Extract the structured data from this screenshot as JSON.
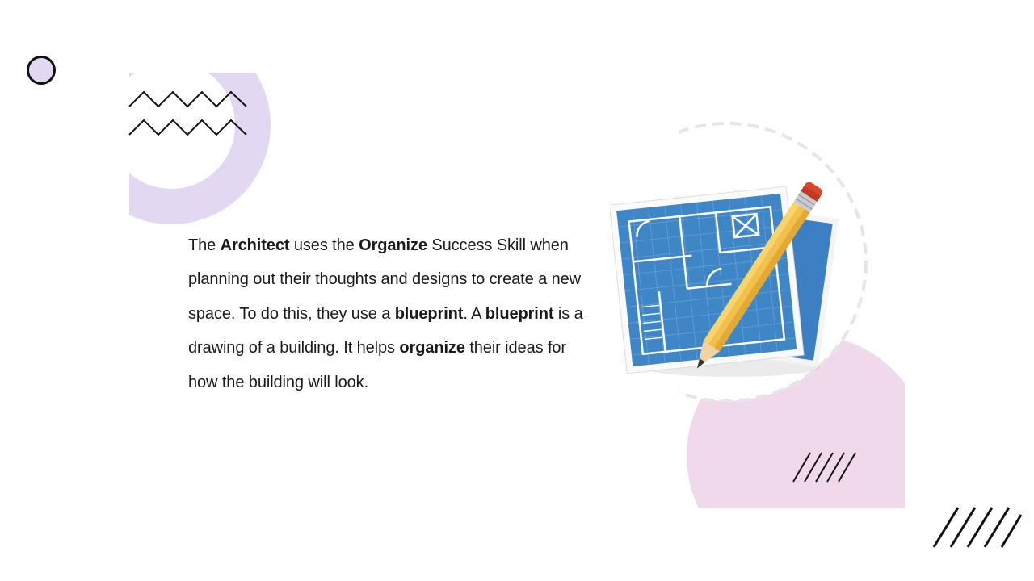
{
  "slide": {
    "paragraph": {
      "t1": "The ",
      "b1": "Architect",
      "t2": " uses the ",
      "b2": "Organize",
      "t3": " Success Skill when planning out their thoughts and designs to create a new space. To do this, they use a ",
      "b3": "blueprint",
      "t4": ". A ",
      "b4": "blueprint",
      "t5": " is a drawing of a building. It helps ",
      "b5": "organize",
      "t6": " their ideas for how the building will look."
    },
    "illustration_icon": "blueprint-pencil-icon"
  },
  "colors": {
    "lavender": "#e3d8f2",
    "pink": "#f1d9ec",
    "ink": "#111111",
    "blueprint_blue": "#3f86c7"
  }
}
